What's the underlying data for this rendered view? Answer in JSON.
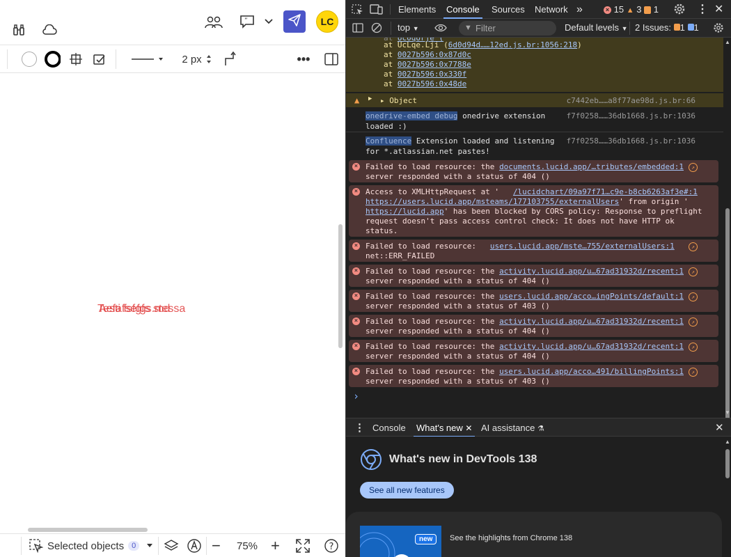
{
  "app": {
    "avatar_initials": "LC",
    "stroke_width": "2 px",
    "canvas_text_a": "Testi fsfgfs stessa",
    "canvas_text_b": "Aefafsefgs.md",
    "selected_objects_label": "Selected objects",
    "selected_count": "0",
    "zoom": "75%"
  },
  "devtools": {
    "tabs": [
      "Elements",
      "Console",
      "Sources",
      "Network"
    ],
    "more_tabs": "»",
    "error_count": "15",
    "warning_count": "3",
    "issue_count_top": "1",
    "context": "top",
    "filter_placeholder": "Filter",
    "default_levels": "Default levels",
    "issues_label": "2 Issues:",
    "issues_warn": "1",
    "issues_info": "1",
    "stack": [
      "at UcLqe.Lji (6d0d94d……12ed.js.br:1056:218)",
      "at 0027b596:0x87d0c",
      "at 0027b596:0x7788e",
      "at 0027b596:0x330f",
      "at 0027b596:0x48de"
    ],
    "stack_prefix": "at UcLqe.Lji (",
    "stack_link_0": "6d0d94d……12ed.js.br:1056:218",
    "stack_suffix": ")",
    "stack_links": [
      "0027b596:0x87d0c",
      "0027b596:0x7788e",
      "0027b596:0x330f",
      "0027b596:0x48de"
    ],
    "at": "at",
    "object_label": "Object",
    "object_src": "c7442eb……a8f77ae98d.js.br:66",
    "logs": {
      "onedrive_tag": "onedrive-embed debug",
      "onedrive_text1": " onedrive extension",
      "onedrive_text2": "loaded :)",
      "onedrive_src": "f7f0258……36db1668.js.br:1036",
      "confluence_tag": "Confluence",
      "confluence_text1": " Extension loaded and listening",
      "confluence_text2": "for *.atlassian.net pastes!",
      "confluence_src": "f7f0258……36db1668.js.br:1036"
    },
    "errors": [
      {
        "l1": "Failed to load resource: the ",
        "link": "documents.lucid.app/…tributes/embedded:1",
        "l2": "server responded with a status of 404 ()"
      },
      {
        "l1": "Failed to load resource:     ",
        "link": "users.lucid.app/mste…755/externalUsers:1",
        "l2": "net::ERR_FAILED"
      },
      {
        "l1": "Failed to load resource: the ",
        "link": "activity.lucid.app/u…67ad31932d/recent:1",
        "l2": "server responded with a status of 404 ()"
      },
      {
        "l1": "Failed to load resource: the ",
        "link": "users.lucid.app/acco…ingPoints/default:1",
        "l2": "server responded with a status of 403 ()"
      },
      {
        "l1": "Failed to load resource: the ",
        "link": "activity.lucid.app/u…67ad31932d/recent:1",
        "l2": "server responded with a status of 404 ()"
      },
      {
        "l1": "Failed to load resource: the ",
        "link": "activity.lucid.app/u…67ad31932d/recent:1",
        "l2": "server responded with a status of 404 ()"
      },
      {
        "l1": "Failed to load resource: the ",
        "link": "users.lucid.app/acco…491/billingPoints:1",
        "l2": "server responded with a status of 403 ()"
      }
    ],
    "cors": {
      "l1a": "Access to XMLHttpRequest at '",
      "l1link": "/lucidchart/09a97f71…c9e-b8cb6263af3e#:1",
      "l2link": "https://users.lucid.app/msteams/177103755/externalUsers",
      "l2b": "' from origin '",
      "l3link": "https://lucid.app",
      "l3b": "' has been blocked by CORS policy: Response to preflight",
      "l4": "request doesn't pass access control check: It does not have HTTP ok",
      "l5": "status."
    },
    "prompt": "›",
    "drawer_tabs": [
      "Console",
      "What's new",
      "AI assistance"
    ],
    "whatsnew_title": "What's new in DevTools 138",
    "see_all": "See all new features",
    "new_badge": "new",
    "highlights": "See the highlights from Chrome 138"
  }
}
